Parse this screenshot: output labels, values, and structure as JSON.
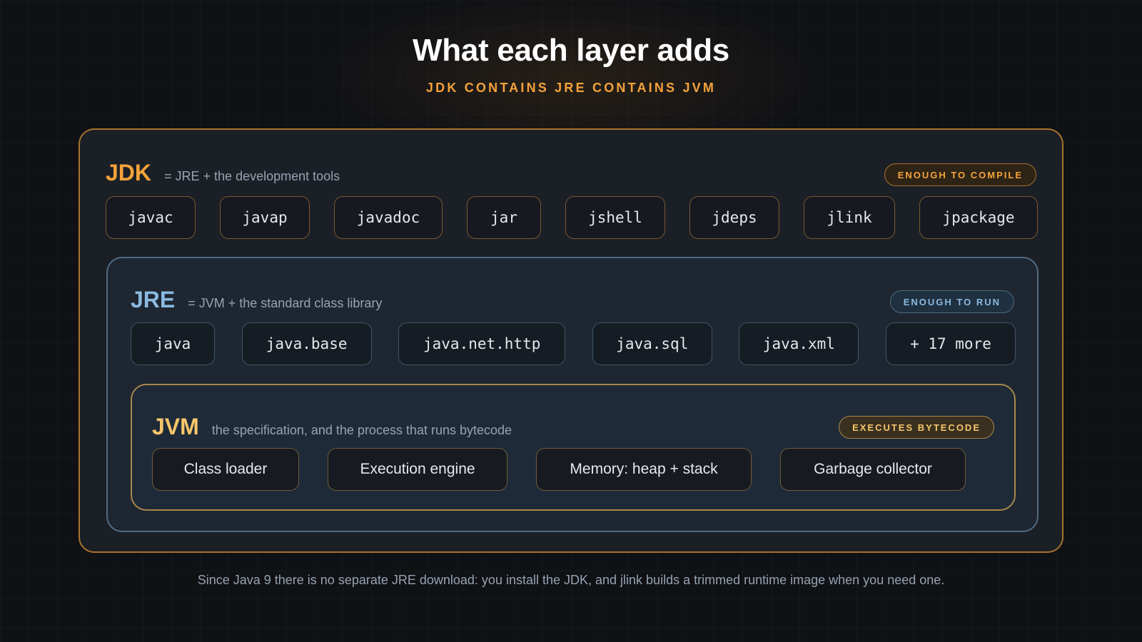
{
  "title": "What each layer adds",
  "subtitle": "JDK CONTAINS JRE CONTAINS JVM",
  "jdk": {
    "name": "JDK",
    "description": "= JRE + the development tools",
    "badge": "ENOUGH TO COMPILE",
    "tools": [
      "javac",
      "javap",
      "javadoc",
      "jar",
      "jshell",
      "jdeps",
      "jlink",
      "jpackage"
    ]
  },
  "jre": {
    "name": "JRE",
    "description": "= JVM + the standard class library",
    "badge": "ENOUGH TO RUN",
    "modules": [
      "java",
      "java.base",
      "java.net.http",
      "java.sql",
      "java.xml",
      "+ 17 more"
    ]
  },
  "jvm": {
    "name": "JVM",
    "description": "the specification, and the process that runs bytecode",
    "badge": "EXECUTES BYTECODE",
    "components": [
      "Class loader",
      "Execution engine",
      "Memory: heap + stack",
      "Garbage collector"
    ]
  },
  "footnote": "Since Java 9 there is no separate JRE download: you install the JDK, and jlink builds a trimmed runtime image when you need one.",
  "colors": {
    "jdk_accent": "#f5a23a",
    "jre_accent": "#8ab9e0",
    "jvm_accent": "#f7c66b",
    "background": "#0f1115"
  }
}
